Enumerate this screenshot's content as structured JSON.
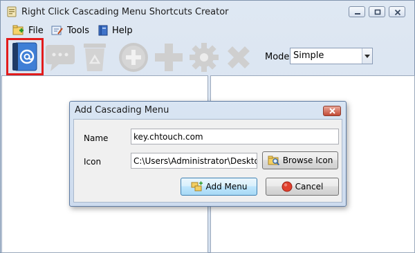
{
  "window": {
    "title": "Right Click Cascading Menu Shortcuts Creator"
  },
  "menubar": {
    "items": [
      {
        "label": "File",
        "icon": "file-icon"
      },
      {
        "label": "Tools",
        "icon": "tools-icon"
      },
      {
        "label": "Help",
        "icon": "help-icon"
      }
    ]
  },
  "toolbar": {
    "tools": [
      {
        "icon": "address-book-icon",
        "enabled": true,
        "highlighted": true
      },
      {
        "icon": "speech-bubble-icon",
        "enabled": false
      },
      {
        "icon": "recycle-bin-icon",
        "enabled": false
      },
      {
        "icon": "add-circle-icon",
        "enabled": false
      },
      {
        "icon": "plus-icon",
        "enabled": false
      },
      {
        "icon": "gear-icon",
        "enabled": false
      },
      {
        "icon": "delete-x-icon",
        "enabled": false
      }
    ],
    "mode_label": "Mode",
    "mode_value": "Simple"
  },
  "dialog": {
    "title": "Add Cascading Menu",
    "name_label": "Name",
    "name_value": "key.chtouch.com",
    "icon_label": "Icon",
    "icon_value": "C:\\Users\\Administrator\\Deskto",
    "browse_label": "Browse Icon",
    "add_label": "Add Menu",
    "cancel_label": "Cancel"
  },
  "colors": {
    "highlight": "#e21b1b",
    "disabled_icon": "#c8c8c8",
    "accent": "#3d7dd6"
  }
}
